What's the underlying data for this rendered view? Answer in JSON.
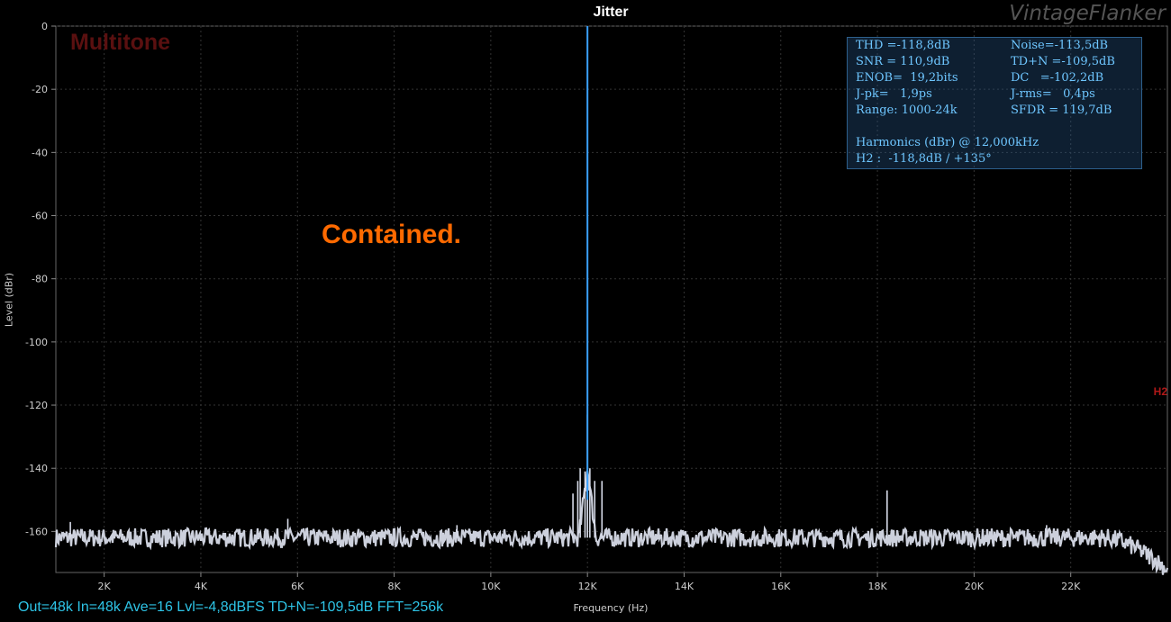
{
  "chart_data": {
    "type": "line",
    "title": "Jitter",
    "xlabel": "Frequency (Hz)",
    "ylabel": "Level (dBr)",
    "xlim": [
      1000,
      24000
    ],
    "ylim": [
      -173,
      0
    ],
    "x_ticks": [
      2000,
      4000,
      6000,
      8000,
      10000,
      12000,
      14000,
      16000,
      18000,
      20000,
      22000
    ],
    "x_tick_labels": [
      "2K",
      "4K",
      "6K",
      "8K",
      "10K",
      "12K",
      "14K",
      "16K",
      "18K",
      "20K",
      "22K"
    ],
    "y_ticks": [
      0,
      -20,
      -40,
      -60,
      -80,
      -100,
      -120,
      -140,
      -160
    ],
    "y_tick_labels": [
      "0",
      "-20",
      "-40",
      "-60",
      "-80",
      "-100",
      "-120",
      "-140",
      "-160"
    ],
    "grid": true,
    "series": [
      {
        "noise_floor_db": -162,
        "main_tone": {
          "x": 12000,
          "y": 0
        },
        "spurs": [
          {
            "x": 1300,
            "y": -157
          },
          {
            "x": 5800,
            "y": -156
          },
          {
            "x": 9300,
            "y": -158
          },
          {
            "x": 11700,
            "y": -148
          },
          {
            "x": 11800,
            "y": -144
          },
          {
            "x": 11850,
            "y": -140
          },
          {
            "x": 11950,
            "y": -141
          },
          {
            "x": 12000,
            "y": -123
          },
          {
            "x": 12050,
            "y": -140
          },
          {
            "x": 12150,
            "y": -144
          },
          {
            "x": 12300,
            "y": -144
          },
          {
            "x": 18200,
            "y": -147
          },
          {
            "x": 21500,
            "y": -158
          }
        ],
        "rolloff_start": 22700,
        "rolloff_end_db": -172,
        "color": "#d7dbe8",
        "tone_color": "#3aa0ff"
      }
    ]
  },
  "brand": "VintageFlanker",
  "label_multitone": "Multitone",
  "annotation": "Contained.",
  "h2_marker": "H2",
  "stats": {
    "r1a": "THD =-118,8dB",
    "r1b": "Noise=-113,5dB",
    "r2a": "SNR = 110,9dB",
    "r2b": "TD+N =-109,5dB",
    "r3a": "ENOB=  19,2bits",
    "r3b": "DC   =-102,2dB",
    "r4a": "J-pk=   1,9ps",
    "r4b": "J-rms=   0,4ps",
    "r5a": "Range: 1000-24k",
    "r5b": "SFDR = 119,7dB",
    "r6": "Harmonics (dBr) @ 12,000kHz",
    "r7": "H2 :  -118,8dB / +135°"
  },
  "footer": "Out=48k In=48k Ave=16 Lvl=-4,8dBFS TD+N=-109,5dB FFT=256k",
  "colors": {
    "grid": "#333333",
    "frame": "#666666",
    "annotation": "#ff6a00",
    "stats_text": "#6ec6ff"
  }
}
